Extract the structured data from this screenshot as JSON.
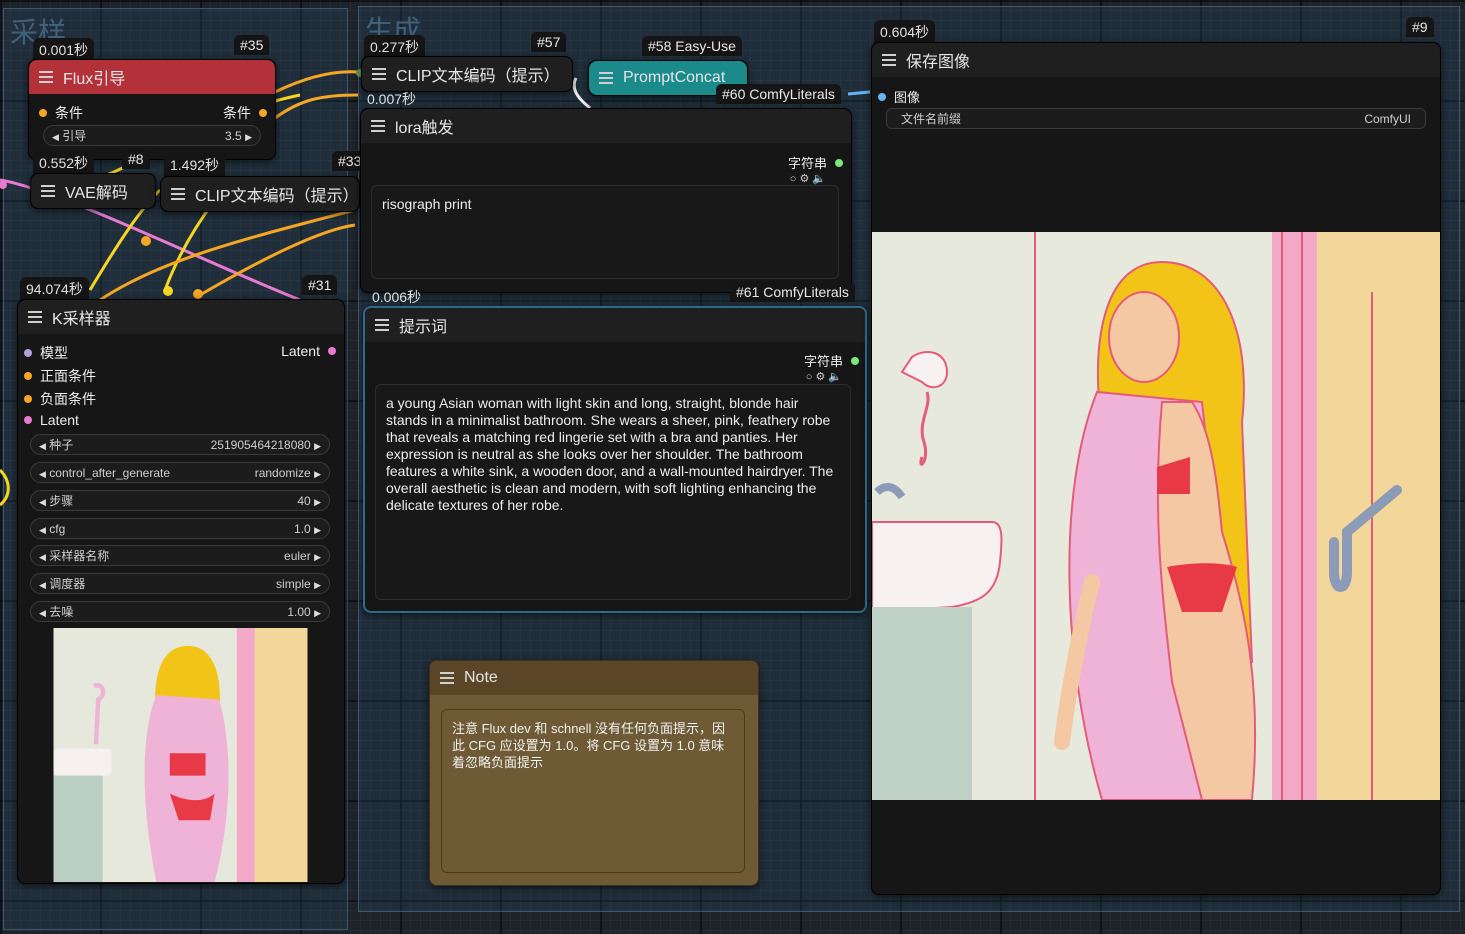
{
  "groups": {
    "sampling": "采样",
    "generate": "生成"
  },
  "flux_guidance": {
    "timing": "0.001秒",
    "id": "#35",
    "title": "Flux引导",
    "input": "条件",
    "output": "条件",
    "widget_label": "引导",
    "widget_value": "3.5"
  },
  "vae_decode": {
    "timing": "0.552秒",
    "id": "#8",
    "title": "VAE解码"
  },
  "clip_left": {
    "timing": "1.492秒",
    "id": "#33",
    "title": "CLIP文本编码（提示）"
  },
  "clip_top": {
    "timing": "0.277秒",
    "id": "#57",
    "title": "CLIP文本编码（提示）"
  },
  "prompt_concat": {
    "id": "#58 Easy-Use",
    "title": "PromptConcat",
    "timing": "0.007秒"
  },
  "lora_trigger": {
    "id": "#60 ComfyLiterals",
    "title": "lora触发",
    "output": "字符串",
    "text": "risograph print",
    "timing": "0.006秒"
  },
  "prompt_node": {
    "id": "#61 ComfyLiterals",
    "title": "提示词",
    "output": "字符串",
    "text": "a young Asian woman with light skin and long, straight, blonde hair stands in a minimalist bathroom. She wears a sheer, pink, feathery robe that reveals a matching red lingerie set with a bra and panties. Her expression is neutral as she looks over her shoulder. The bathroom features a white sink, a wooden door, and a wall-mounted hairdryer. The overall aesthetic is clean and modern, with soft lighting enhancing the delicate textures of her robe."
  },
  "ksampler": {
    "timing": "94.074秒",
    "id": "#31",
    "title": "K采样器",
    "inputs": [
      "模型",
      "正面条件",
      "负面条件",
      "Latent"
    ],
    "output": "Latent",
    "widgets": [
      {
        "label": "种子",
        "value": "251905464218080"
      },
      {
        "label": "control_after_generate",
        "value": "randomize"
      },
      {
        "label": "步骤",
        "value": "40"
      },
      {
        "label": "cfg",
        "value": "1.0"
      },
      {
        "label": "采样器名称",
        "value": "euler"
      },
      {
        "label": "调度器",
        "value": "simple"
      },
      {
        "label": "去噪",
        "value": "1.00"
      }
    ]
  },
  "note": {
    "title": "Note",
    "text": "注意 Flux dev 和 schnell 没有任何负面提示，因此 CFG 应设置为 1.0。将 CFG 设置为 1.0 意味着忽略负面提示"
  },
  "save_image": {
    "timing": "0.604秒",
    "id": "#9",
    "title": "保存图像",
    "input": "图像",
    "widget_label": "文件名前缀",
    "widget_value": "ComfyUI"
  },
  "colors": {
    "conditioning": "#f5a623",
    "latent": "#e97ad1",
    "model": "#b39ddb",
    "image": "#64b5f6",
    "string": "#7be87b",
    "flux_header": "#b3323a",
    "concat_header": "#1a8a8a",
    "note_bg": "#6e5a34"
  }
}
